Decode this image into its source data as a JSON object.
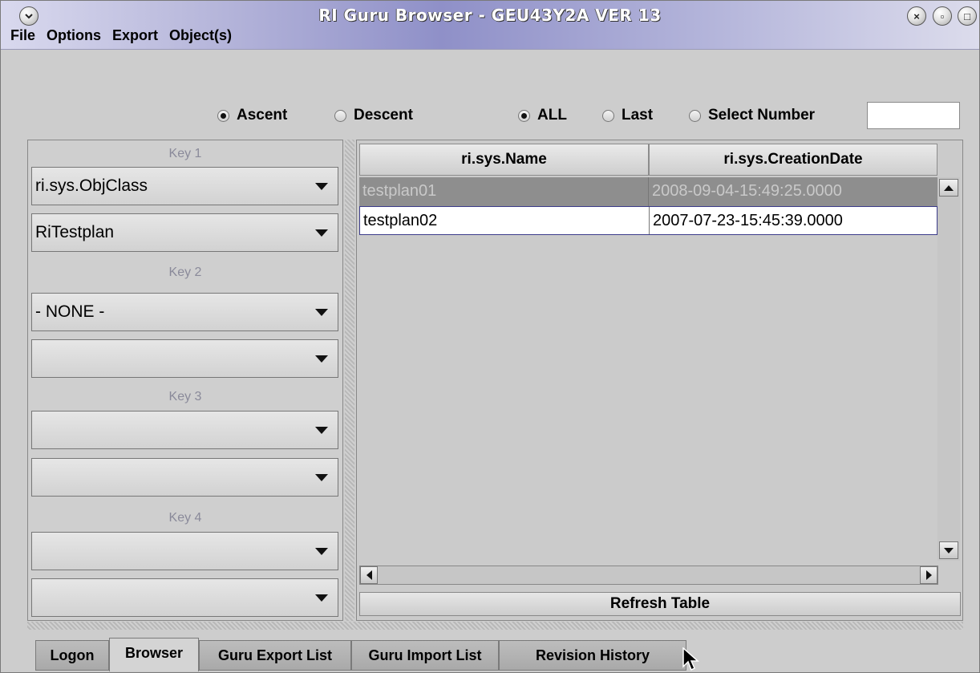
{
  "window": {
    "title": "RI Guru Browser - GEU43Y2A  VER 13",
    "controls": {
      "close": "×",
      "minimize": "▫",
      "maximize": "□"
    }
  },
  "menu": [
    "File",
    "Options",
    "Export",
    "Object(s)"
  ],
  "toolbar": {
    "sort_options": [
      {
        "label": "Ascent",
        "selected": true
      },
      {
        "label": "Descent",
        "selected": false
      }
    ],
    "range_options": [
      {
        "label": "ALL",
        "selected": true
      },
      {
        "label": "Last",
        "selected": false
      },
      {
        "label": "Select Number",
        "selected": false
      }
    ],
    "select_number_value": ""
  },
  "keys": {
    "key1_label": "Key 1",
    "key1_field": "ri.sys.ObjClass",
    "key1_value": "RiTestplan",
    "key2_label": "Key 2",
    "key2_field": "- NONE -",
    "key2_value": "",
    "key3_label": "Key 3",
    "key3_field": "",
    "key3_value": "",
    "key4_label": "Key 4",
    "key4_field": "",
    "key4_value": ""
  },
  "table": {
    "columns": [
      "ri.sys.Name",
      "ri.sys.CreationDate"
    ],
    "rows": [
      {
        "name": "testplan01",
        "date": "2008-09-04-15:49:25.0000",
        "selected": true
      },
      {
        "name": "testplan02",
        "date": "2007-07-23-15:45:39.0000",
        "selected": false
      }
    ],
    "refresh_label": "Refresh Table"
  },
  "tabs": [
    "Logon",
    "Browser",
    "Guru Export List",
    "Guru Import List",
    "Revision History"
  ],
  "active_tab": "Browser",
  "colors": {
    "title_gradient_mid": "#8f90c8",
    "selected_row": "#8e8e8e",
    "key_label": "#8a8a9a"
  }
}
